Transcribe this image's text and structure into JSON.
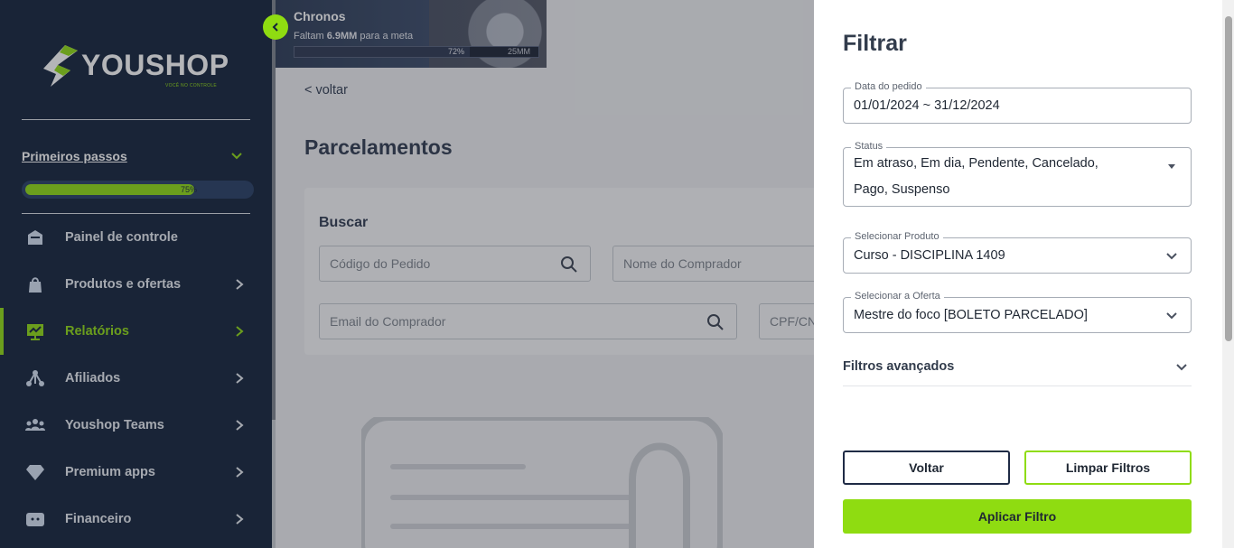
{
  "brand": {
    "name": "YOUSHOP",
    "tagline": "VOCÊ NO CONTROLE",
    "accent": "#8fdc11",
    "sidebar_bg": "#122139"
  },
  "sidebar": {
    "first_steps": {
      "label": "Primeiros passos",
      "progress_percent": 75,
      "progress_label": "75%"
    },
    "items": [
      {
        "label": "Painel de controle",
        "icon": "dashboard-icon",
        "active": false,
        "has_arrow": false
      },
      {
        "label": "Produtos e ofertas",
        "icon": "shopping-bag-icon",
        "active": false,
        "has_arrow": true
      },
      {
        "label": "Relatórios",
        "icon": "report-icon",
        "active": true,
        "has_arrow": true
      },
      {
        "label": "Afiliados",
        "icon": "affiliates-icon",
        "active": false,
        "has_arrow": true
      },
      {
        "label": "Youshop Teams",
        "icon": "team-icon",
        "active": false,
        "has_arrow": true
      },
      {
        "label": "Premium apps",
        "icon": "diamond-icon",
        "active": false,
        "has_arrow": true
      },
      {
        "label": "Financeiro",
        "icon": "wallet-icon",
        "active": false,
        "has_arrow": true
      }
    ]
  },
  "banner": {
    "title": "Chronos",
    "subtitle_prefix": "Faltam",
    "subtitle_amount": "6.9MM",
    "subtitle_suffix": "para a meta",
    "progress_percent": 72,
    "progress_label": "72%",
    "goal_label": "25MM"
  },
  "main": {
    "back_label": "< voltar",
    "title": "Parcelamentos",
    "search": {
      "heading": "Buscar",
      "order_code_placeholder": "Código do Pedido",
      "buyer_name_placeholder": "Nome do Comprador",
      "buyer_email_placeholder": "Email do Comprador",
      "cpf_placeholder": "CPF/CN"
    }
  },
  "filter": {
    "title": "Filtrar",
    "order_date": {
      "label": "Data do pedido",
      "value": "01/01/2024 ~ 31/12/2024"
    },
    "status": {
      "label": "Status",
      "line1": "Em atraso, Em dia, Pendente, Cancelado,",
      "line2": "Pago, Suspenso"
    },
    "product": {
      "label": "Selecionar Produto",
      "value": "Curso - DISCIPLINA 1409"
    },
    "offer": {
      "label": "Selecionar a Oferta",
      "value": "Mestre do foco [BOLETO PARCELADO]"
    },
    "advanced_label": "Filtros avançados",
    "back_button": "Voltar",
    "clear_button": "Limpar Filtros",
    "apply_button": "Aplicar Filtro"
  }
}
